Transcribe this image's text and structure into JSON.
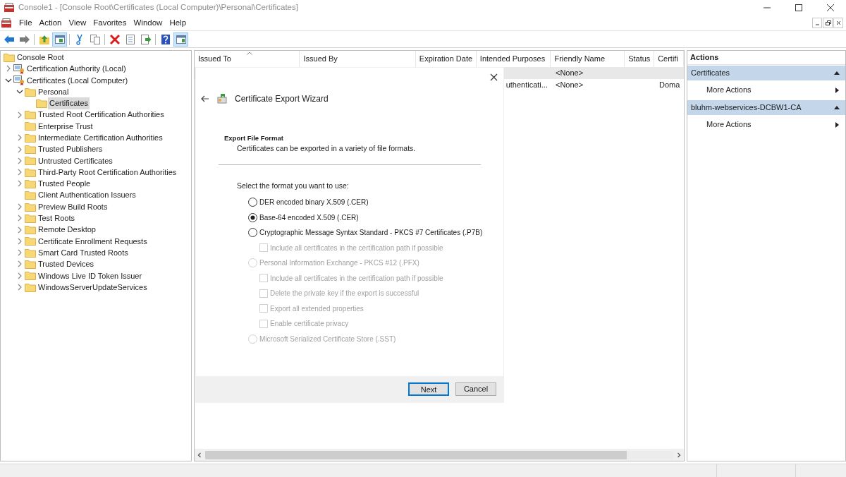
{
  "window": {
    "title": "Console1 - [Console Root\\Certificates (Local Computer)\\Personal\\Certificates]"
  },
  "menu": [
    "File",
    "Action",
    "View",
    "Favorites",
    "Window",
    "Help"
  ],
  "toolbar": [
    {
      "kind": "back",
      "pressed": false
    },
    {
      "kind": "forward",
      "pressed": false
    },
    {
      "kind": "up",
      "pressed": false
    },
    {
      "kind": "console_tree",
      "pressed": true
    },
    {
      "kind": "cut",
      "pressed": false
    },
    {
      "kind": "copy",
      "pressed": false
    },
    {
      "kind": "delete",
      "pressed": false
    },
    {
      "kind": "properties",
      "pressed": false
    },
    {
      "kind": "export",
      "pressed": false
    },
    {
      "kind": "help",
      "pressed": false
    },
    {
      "kind": "action_pane",
      "pressed": true
    }
  ],
  "tree": [
    {
      "label": "Console Root",
      "kind": "folder",
      "selected": false,
      "children": [
        {
          "label": "Certification Authority (Local)",
          "kind": "snapin",
          "expanded": false,
          "selected": false
        },
        {
          "label": "Certificates (Local Computer)",
          "kind": "snapin",
          "expanded": true,
          "selected": false,
          "children": [
            {
              "label": "Personal",
              "kind": "folder",
              "expanded": true,
              "selected": false,
              "children": [
                {
                  "label": "Certificates",
                  "kind": "folder",
                  "selected": true
                }
              ]
            },
            {
              "label": "Trusted Root Certification Authorities",
              "kind": "folder",
              "expanded": false,
              "selected": false
            },
            {
              "label": "Enterprise Trust",
              "kind": "folder",
              "selected": false
            },
            {
              "label": "Intermediate Certification Authorities",
              "kind": "folder",
              "expanded": false,
              "selected": false
            },
            {
              "label": "Trusted Publishers",
              "kind": "folder",
              "expanded": false,
              "selected": false
            },
            {
              "label": "Untrusted Certificates",
              "kind": "folder",
              "expanded": false,
              "selected": false
            },
            {
              "label": "Third-Party Root Certification Authorities",
              "kind": "folder",
              "expanded": false,
              "selected": false
            },
            {
              "label": "Trusted People",
              "kind": "folder",
              "expanded": false,
              "selected": false
            },
            {
              "label": "Client Authentication Issuers",
              "kind": "folder",
              "selected": false
            },
            {
              "label": "Preview Build Roots",
              "kind": "folder",
              "expanded": false,
              "selected": false
            },
            {
              "label": "Test Roots",
              "kind": "folder",
              "expanded": false,
              "selected": false
            },
            {
              "label": "Remote Desktop",
              "kind": "folder",
              "expanded": false,
              "selected": false
            },
            {
              "label": "Certificate Enrollment Requests",
              "kind": "folder",
              "expanded": false,
              "selected": false
            },
            {
              "label": "Smart Card Trusted Roots",
              "kind": "folder",
              "expanded": false,
              "selected": false
            },
            {
              "label": "Trusted Devices",
              "kind": "folder",
              "expanded": false,
              "selected": false
            },
            {
              "label": "Windows Live ID Token Issuer",
              "kind": "folder",
              "expanded": false,
              "selected": false
            },
            {
              "label": "WindowsServerUpdateServices",
              "kind": "folder",
              "expanded": false,
              "selected": false
            }
          ]
        }
      ]
    }
  ],
  "table": {
    "columns": [
      {
        "label": "Issued To",
        "sorted": true
      },
      {
        "label": "Issued By",
        "sorted": false
      },
      {
        "label": "Expiration Date",
        "sorted": false
      },
      {
        "label": "Intended Purposes",
        "sorted": false
      },
      {
        "label": "Friendly Name",
        "sorted": false
      },
      {
        "label": "Status",
        "sorted": false
      },
      {
        "label": "Certifi",
        "sorted": false
      }
    ],
    "rows": [
      {
        "selected": true,
        "cells": {
          "friendly_name": "<None>"
        }
      },
      {
        "selected": false,
        "cells": {
          "intended_purposes": "uthenticati...",
          "friendly_name": "<None>",
          "column_7": "Doma"
        }
      }
    ]
  },
  "wizard": {
    "title": "Certificate Export Wizard",
    "heading": "Export File Format",
    "subheading": "Certificates can be exported in a variety of file formats.",
    "prompt": "Select the format you want to use:",
    "options": [
      {
        "kind": "radio",
        "label": "DER encoded binary X.509 (.CER)",
        "selected": false,
        "disabled": false
      },
      {
        "kind": "radio",
        "label": "Base-64 encoded X.509 (.CER)",
        "selected": true,
        "disabled": false
      },
      {
        "kind": "radio",
        "label": "Cryptographic Message Syntax Standard - PKCS #7 Certificates (.P7B)",
        "selected": false,
        "disabled": false,
        "children": [
          {
            "kind": "checkbox",
            "label": "Include all certificates in the certification path if possible",
            "checked": false,
            "disabled": true
          }
        ]
      },
      {
        "kind": "radio",
        "label": "Personal Information Exchange - PKCS #12 (.PFX)",
        "selected": false,
        "disabled": true,
        "children": [
          {
            "kind": "checkbox",
            "label": "Include all certificates in the certification path if possible",
            "checked": false,
            "disabled": true
          },
          {
            "kind": "checkbox",
            "label": "Delete the private key if the export is successful",
            "checked": false,
            "disabled": true
          },
          {
            "kind": "checkbox",
            "label": "Export all extended properties",
            "checked": false,
            "disabled": true
          },
          {
            "kind": "checkbox",
            "label": "Enable certificate privacy",
            "checked": false,
            "disabled": true
          }
        ]
      },
      {
        "kind": "radio",
        "label": "Microsoft Serialized Certificate Store (.SST)",
        "selected": false,
        "disabled": true
      }
    ],
    "buttons": [
      {
        "label": "Next",
        "default": true
      },
      {
        "label": "Cancel",
        "default": false
      }
    ]
  },
  "actions": {
    "title": "Actions",
    "sections": [
      {
        "title": "Certificates",
        "expanded": true,
        "items": [
          "More Actions"
        ]
      },
      {
        "title": "bluhm-webservices-DCBW1-CA",
        "expanded": true,
        "items": [
          "More Actions"
        ]
      }
    ]
  }
}
